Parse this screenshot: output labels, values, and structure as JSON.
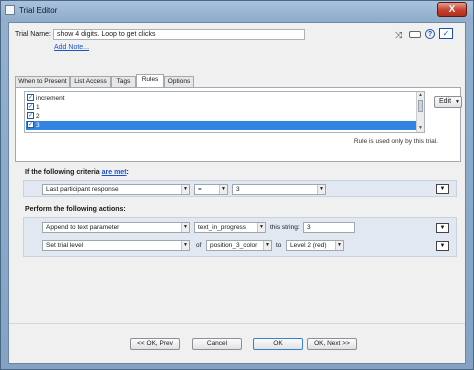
{
  "window": {
    "title": "Trial Editor",
    "close_label": "X"
  },
  "trial": {
    "name_label": "Trial Name:",
    "name_value": "show 4 digits. Loop to get clicks",
    "add_note": "Add Note..."
  },
  "toolbar_icons": [
    "shuffle-icon",
    "toggle-icon",
    "help-icon",
    "check-icon"
  ],
  "toolbar": {
    "help": "?",
    "check": "✓"
  },
  "tabs": [
    {
      "label": "When to Present"
    },
    {
      "label": "List Access"
    },
    {
      "label": "Tags"
    },
    {
      "label": "Rules"
    },
    {
      "label": "Options"
    }
  ],
  "rules": {
    "items": [
      {
        "label": "increment",
        "checked": true
      },
      {
        "label": "1",
        "checked": true
      },
      {
        "label": "2",
        "checked": true
      },
      {
        "label": "3",
        "checked": true
      }
    ],
    "edit_label": "Edit",
    "note": "Rule is used only by this trial."
  },
  "criteria": {
    "header_prefix": "If the following criteria ",
    "header_link": "are met",
    "header_suffix": ":",
    "field": "Last participant response",
    "operator": "=",
    "value": "3"
  },
  "actions": {
    "header": "Perform the following actions:",
    "row1": {
      "action": "Append to text parameter",
      "param": "text_in_progress",
      "string_label": "this string:",
      "string_value": "3"
    },
    "row2": {
      "action": "Set trial level",
      "of_label": "of",
      "param": "position_3_color",
      "to_label": "to",
      "level": "Level 2 (red)"
    }
  },
  "buttons": {
    "prev": "<< OK, Prev",
    "cancel": "Cancel",
    "ok": "OK",
    "next": "OK, Next >>"
  }
}
